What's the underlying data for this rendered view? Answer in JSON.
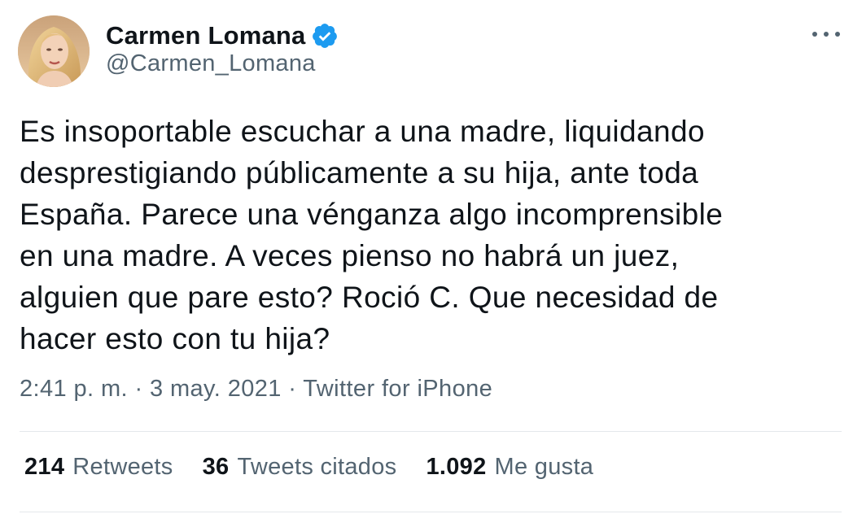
{
  "author": {
    "display_name": "Carmen Lomana",
    "handle": "@Carmen_Lomana",
    "verified": true
  },
  "tweet": {
    "lines": [
      "Es insoportable escuchar a una madre, liquidando",
      "desprestigiando públicamente a su hija, ante toda",
      "España. Parece una vénganza algo incomprensible",
      "en una madre. A veces pienso no habrá un juez,",
      "alguien que pare esto? Roció C. Que necesidad de",
      "hacer esto con tu hija?"
    ]
  },
  "meta": {
    "time": "2:41 p. m.",
    "separator1": "·",
    "date": "3 may. 2021",
    "separator2": "·",
    "source": "Twitter for iPhone"
  },
  "stats": {
    "retweets": {
      "count": "214",
      "label": "Retweets"
    },
    "quotes": {
      "count": "36",
      "label": "Tweets citados"
    },
    "likes": {
      "count": "1.092",
      "label": "Me gusta"
    }
  },
  "icons": {
    "verified": "verified-badge-icon",
    "more": "more-options-icon"
  },
  "colors": {
    "text_primary": "#0f1419",
    "text_secondary": "#536471",
    "verified_blue": "#1d9bf0",
    "divider": "#e4e8eb"
  }
}
